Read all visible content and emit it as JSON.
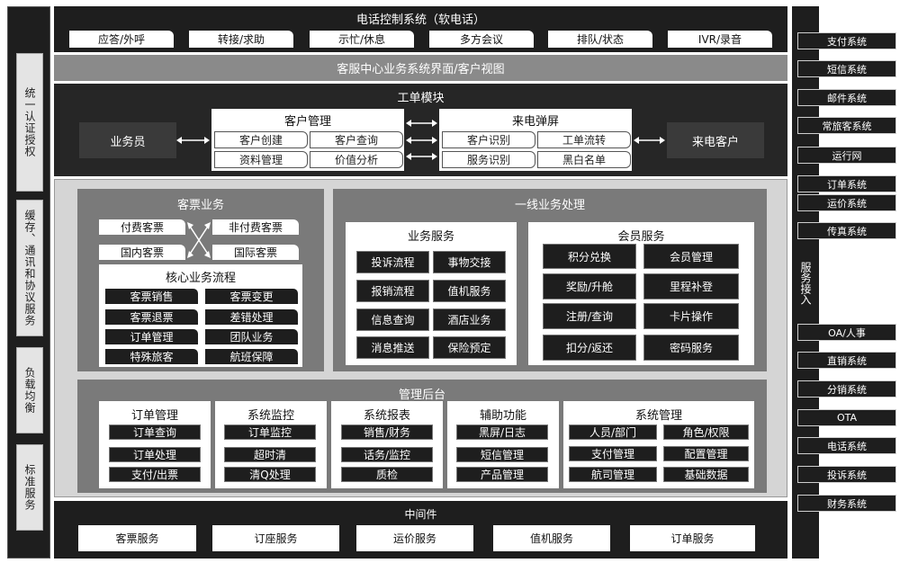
{
  "left_column": {
    "items": [
      {
        "label": "统一认证授权"
      },
      {
        "label": "缓存、通讯和协议服务"
      },
      {
        "label": "负载均衡"
      },
      {
        "label": "标准服务"
      }
    ]
  },
  "phone_control": {
    "title": "电话控制系统（软电话）",
    "buttons": [
      "应答/外呼",
      "转接/求助",
      "示忙/休息",
      "多方会议",
      "排队/状态",
      "IVR/录音"
    ]
  },
  "view_bar": {
    "title": "客服中心业务系统界面/客户视图"
  },
  "work_order": {
    "title": "工单模块",
    "agent": "业务员",
    "caller": "来电客户",
    "customer_mgmt": {
      "title": "客户管理",
      "items": [
        "客户创建",
        "客户查询",
        "资料管理",
        "价值分析"
      ]
    },
    "incoming_popup": {
      "title": "来电弹屏",
      "items": [
        "客户识别",
        "工单流转",
        "服务识别",
        "黑白名单"
      ]
    }
  },
  "ticket_business": {
    "title": "客票业务",
    "types": [
      "付费客票",
      "非付费客票",
      "国内客票",
      "国际客票"
    ],
    "core_flow": {
      "title": "核心业务流程",
      "items": [
        "客票销售",
        "客票变更",
        "客票退票",
        "差错处理",
        "订单管理",
        "团队业务",
        "特殊旅客",
        "航班保障"
      ]
    }
  },
  "frontline": {
    "title": "一线业务处理",
    "business_service": {
      "title": "业务服务",
      "items": [
        "投诉流程",
        "事物交接",
        "报销流程",
        "值机服务",
        "信息查询",
        "酒店业务",
        "消息推送",
        "保险预定"
      ]
    },
    "member_service": {
      "title": "会员服务",
      "items": [
        "积分兑换",
        "会员管理",
        "奖励/升舱",
        "里程补登",
        "注册/查询",
        "卡片操作",
        "扣分/返还",
        "密码服务"
      ]
    }
  },
  "admin": {
    "title": "管理后台",
    "columns": [
      {
        "title": "订单管理",
        "items": [
          "订单查询",
          "订单处理",
          "支付/出票"
        ]
      },
      {
        "title": "系统监控",
        "items": [
          "订单监控",
          "超时清",
          "清Q处理"
        ]
      },
      {
        "title": "系统报表",
        "items": [
          "销售/财务",
          "话务/监控",
          "质检"
        ]
      },
      {
        "title": "辅助功能",
        "items": [
          "黑屏/日志",
          "短信管理",
          "产品管理"
        ]
      },
      {
        "title": "系统管理",
        "items": [
          "人员/部门",
          "角色/权限",
          "支付管理",
          "配置管理",
          "航司管理",
          "基础数据"
        ]
      }
    ]
  },
  "middleware": {
    "title": "中间件",
    "items": [
      "客票服务",
      "订座服务",
      "运价服务",
      "值机服务",
      "订单服务"
    ]
  },
  "service_access": {
    "label": "服务接入",
    "items": [
      "支付系统",
      "短信系统",
      "邮件系统",
      "常旅客系统",
      "运行网",
      "订单系统",
      "运价系统",
      "传真系统",
      "OA/人事",
      "直销系统",
      "分销系统",
      "OTA",
      "电话系统",
      "投诉系统",
      "财务系统"
    ]
  }
}
